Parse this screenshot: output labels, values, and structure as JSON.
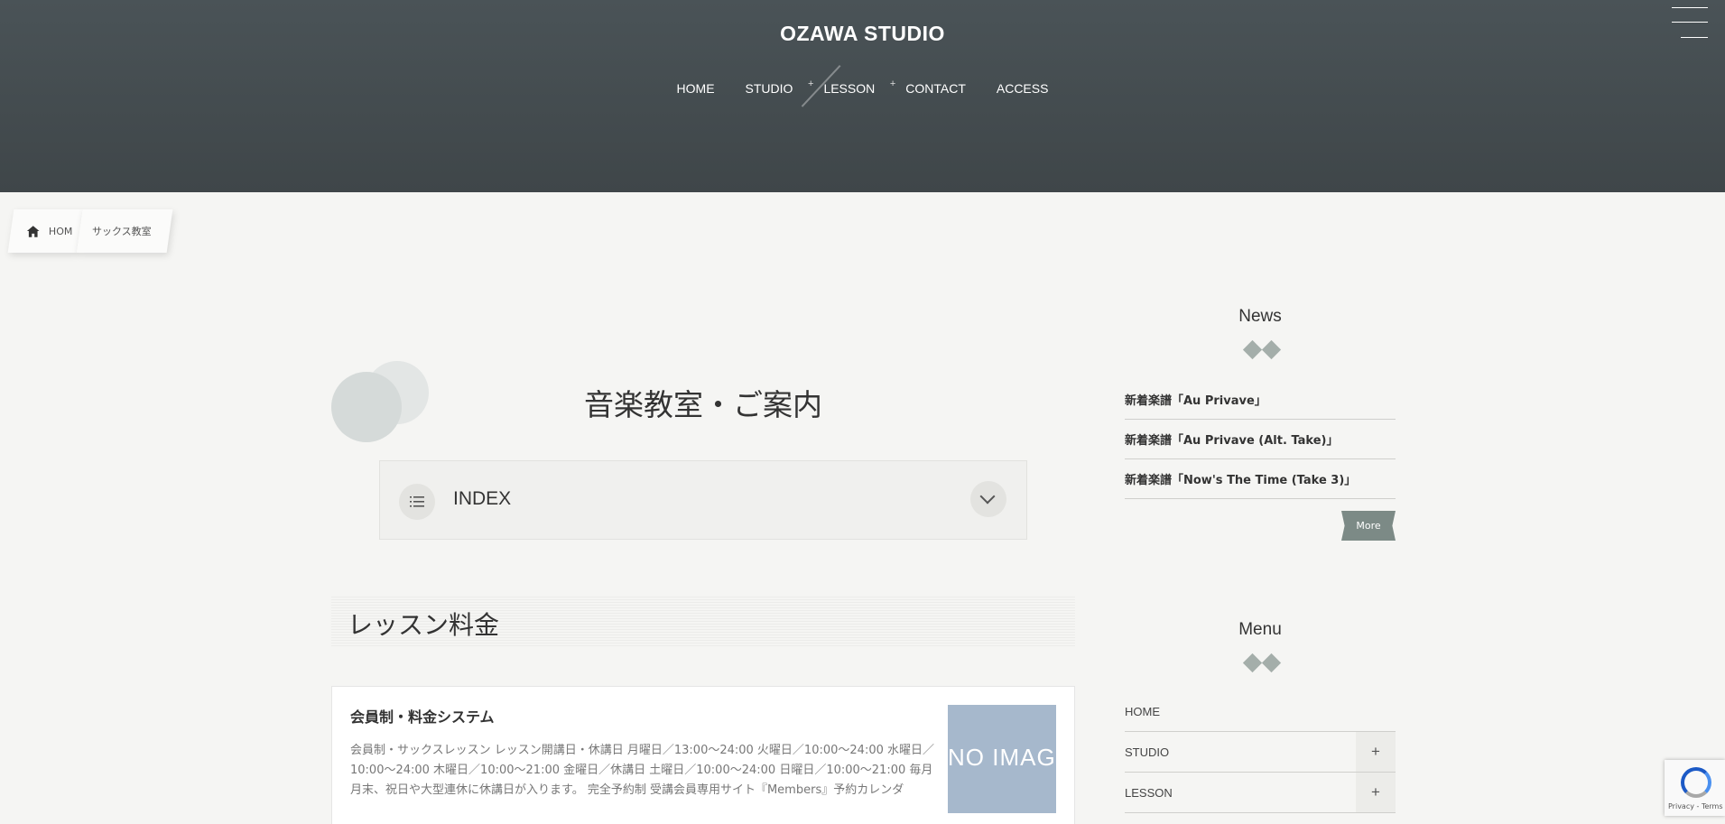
{
  "header": {
    "site_title": "OZAWA STUDIO",
    "nav": [
      {
        "label": "HOME",
        "has_sub": false
      },
      {
        "label": "STUDIO",
        "has_sub": true
      },
      {
        "label": "LESSON",
        "has_sub": true
      },
      {
        "label": "CONTACT",
        "has_sub": false
      },
      {
        "label": "ACCESS",
        "has_sub": false
      }
    ],
    "submenu_symbol": "+"
  },
  "breadcrumb": {
    "home_label": "HOM",
    "current_label": "サックス教室"
  },
  "main": {
    "page_title": "音楽教室・ご案内",
    "index_label": "INDEX",
    "section_heading": "レッスン料金",
    "post": {
      "title": "会員制・料金システム",
      "excerpt": "会員制・サックスレッスン レッスン開講日・休講日 月曜日／13:00〜24:00 火曜日／10:00〜24:00 水曜日／10:00〜24:00 木曜日／10:00〜21:00 金曜日／休講日 土曜日／10:00〜24:00 日曜日／10:00〜21:00 毎月月末、祝日や大型連休に休講日が入ります。 完全予約制 受講会員専用サイト『Members』予約カレンダ",
      "thumbnail_text": "NO IMAGE"
    }
  },
  "sidebar": {
    "news_title": "News",
    "news_items": [
      "新着楽譜「Au Privave」",
      "新着楽譜「Au Privave (Alt. Take)」",
      "新着楽譜「Now's The Time (Take 3)」"
    ],
    "more_label": "More",
    "menu_title": "Menu",
    "menu_items": [
      {
        "label": "HOME",
        "expandable": false
      },
      {
        "label": "STUDIO",
        "expandable": true
      },
      {
        "label": "LESSON",
        "expandable": true
      }
    ],
    "expand_symbol": "+"
  },
  "recaptcha": {
    "text": "Privacy - Terms"
  },
  "colors": {
    "header_bg": "#454d51",
    "page_bg": "#f5f5f3",
    "accent": "#7c8a86",
    "thumb_bg": "#a6b8cc"
  }
}
